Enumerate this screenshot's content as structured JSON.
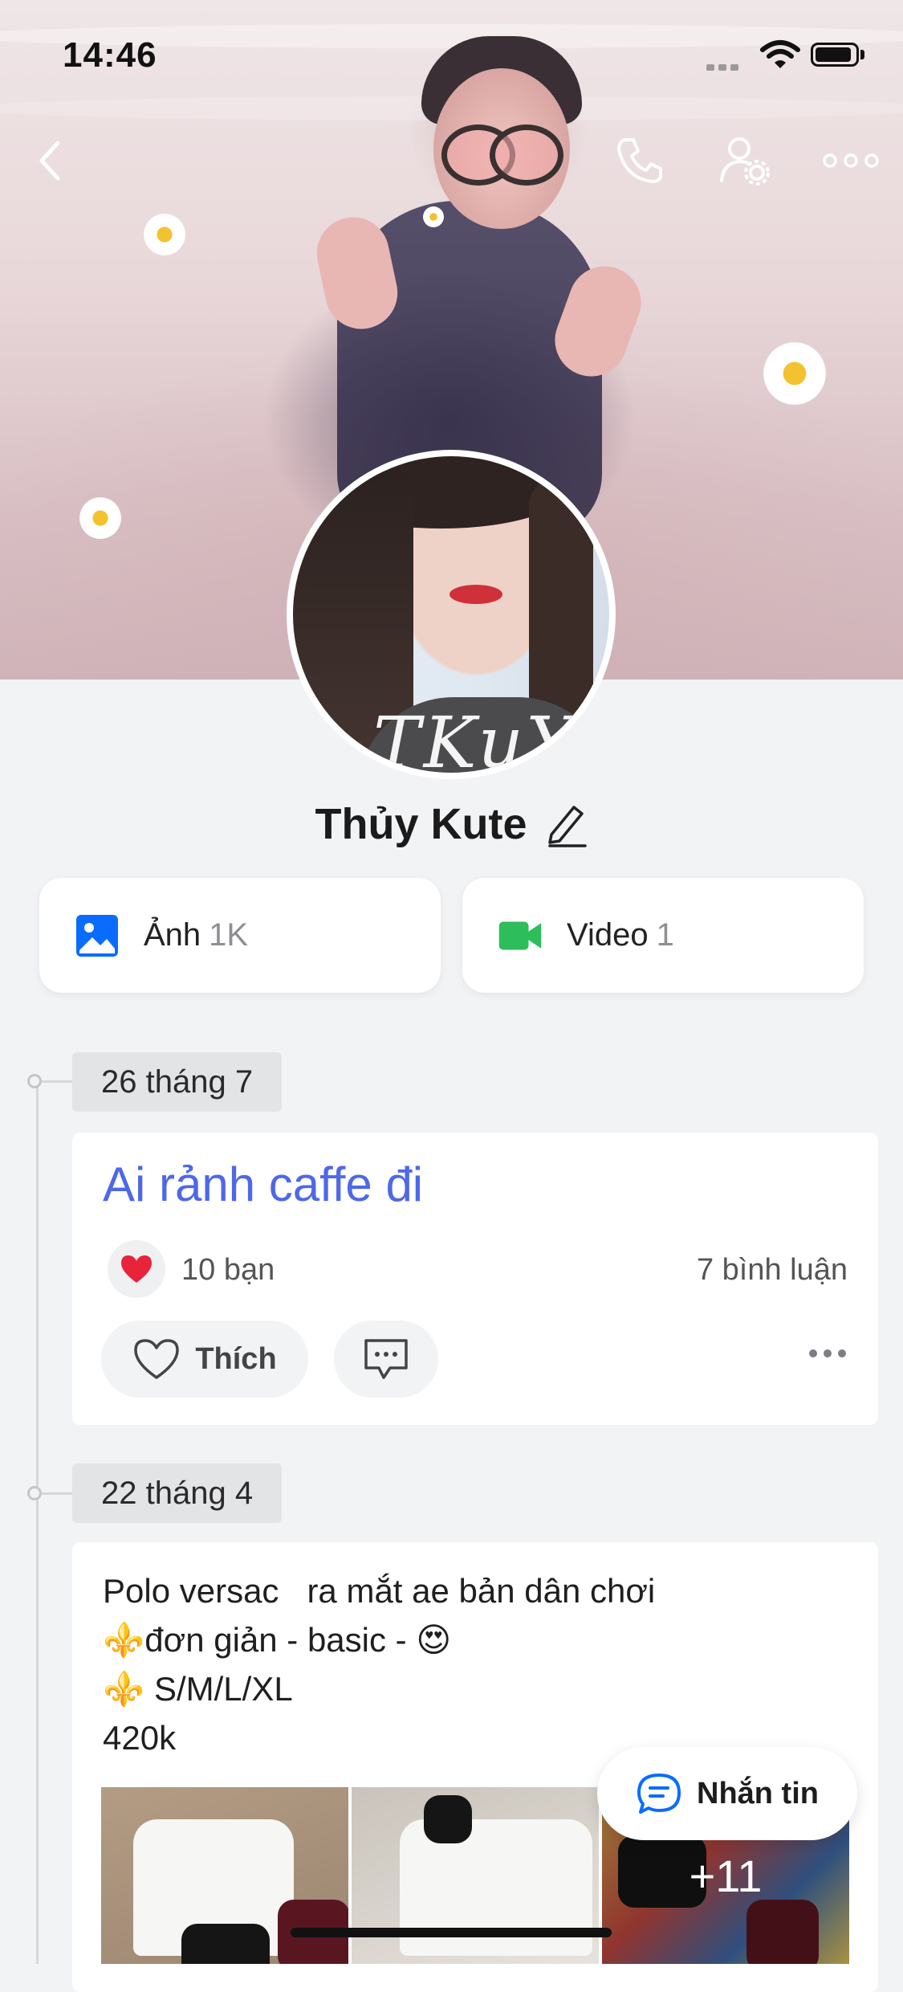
{
  "status_bar": {
    "time": "14:46"
  },
  "profile": {
    "name": "Thủy Kute",
    "avatar_text": "TKuY"
  },
  "media": {
    "photos": {
      "label": "Ảnh",
      "count": "1K"
    },
    "videos": {
      "label": "Video",
      "count": "1"
    }
  },
  "icons": {
    "back": "chevron-left-icon",
    "call": "phone-icon",
    "profile_settings": "user-gear-icon",
    "more": "more-horizontal-icon",
    "edit": "pencil-icon",
    "photo": "image-icon",
    "video": "video-camera-icon",
    "heart": "heart-icon",
    "comment": "comment-bubble-icon",
    "chat": "chat-icon"
  },
  "colors": {
    "accent_blue": "#0a6cff",
    "post_title": "#4e68e8",
    "video_green": "#2dbd5b",
    "heart_red": "#e8243a"
  },
  "timeline": {
    "post1": {
      "date": "26 tháng 7",
      "title": "Ai rảnh caffe đi",
      "likes": "10 bạn",
      "comments": "7 bình luận",
      "like_label": "Thích"
    },
    "post2": {
      "date": "22 tháng 4",
      "lines": [
        "Polo versac   ra mắt ae bản dân chơi",
        "⚜️đơn giản - basic - 😍",
        "⚜️ S/M/L/XL",
        "420k"
      ],
      "more_photos": "+11"
    }
  },
  "chat_button": {
    "label": "Nhắn tin"
  }
}
